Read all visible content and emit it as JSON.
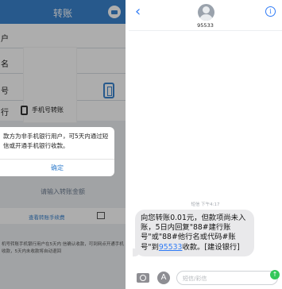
{
  "left_app": {
    "nav_title": "转账",
    "labels": [
      "户",
      "名",
      "号",
      "行"
    ],
    "phone_transfer_label": "手机号转账",
    "dialog": {
      "message": "款方为非手机银行用户，可5天内通过短信或开通手机银行收款。",
      "confirm_label": "确定"
    },
    "amount_hint": "请输入转账金额",
    "fee_link": "查看转账手续费",
    "notes": "机号转账手机银行用户在5天内 信确认收款，可到网点开通手机 收款，5天内未收款将自动退回"
  },
  "sms": {
    "sender": "95533",
    "timestamp": "短信 下午4:17",
    "message_parts": {
      "text": "向您转账0.01元，但款项尚未入账，5日内回复\"88#建行账号\"或\"88#他行名或代码#账号\"到",
      "link": "95533",
      "suffix": "收款。[建设银行]"
    },
    "input_placeholder": "短信/彩信",
    "colors": {
      "accent": "#2f7bf6",
      "bubble": "#e9e9eb",
      "send": "#34c759"
    }
  },
  "icons": [
    "chevron-left-icon",
    "contact-avatar-icon",
    "info-icon",
    "camera-icon",
    "app-store-icon",
    "send-arrow-icon",
    "phone-icon",
    "card-icon",
    "fee-icon"
  ]
}
